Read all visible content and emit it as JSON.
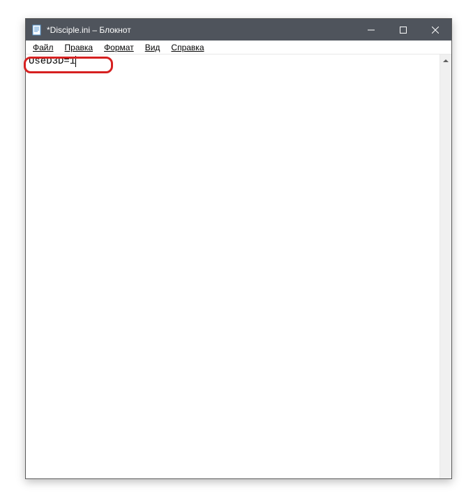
{
  "titlebar": {
    "title": "*Disciple.ini – Блокнот"
  },
  "menubar": {
    "file": "Файл",
    "edit": "Правка",
    "format": "Формат",
    "view": "Вид",
    "help": "Справка"
  },
  "content": {
    "text": "UseD3D=1"
  }
}
